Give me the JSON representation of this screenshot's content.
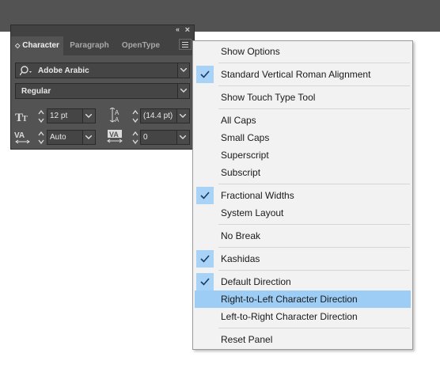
{
  "panel": {
    "collapse_glyph": "«",
    "close_glyph": "×",
    "tabs": [
      {
        "label": "Character",
        "active": true
      },
      {
        "label": "Paragraph",
        "active": false
      },
      {
        "label": "OpenType",
        "active": false
      }
    ],
    "font_family": "Adobe Arabic",
    "font_style": "Regular",
    "font_size": "12 pt",
    "leading": "(14.4 pt)",
    "kerning": "Auto",
    "tracking": "0"
  },
  "menu": {
    "items": [
      {
        "label": "Show Options",
        "checked": false,
        "highlighted": false
      },
      {
        "label": "Standard Vertical Roman Alignment",
        "checked": true,
        "highlighted": false
      },
      {
        "label": "Show Touch Type Tool",
        "checked": false,
        "highlighted": false
      },
      {
        "label": "All Caps",
        "checked": false,
        "highlighted": false
      },
      {
        "label": "Small Caps",
        "checked": false,
        "highlighted": false
      },
      {
        "label": "Superscript",
        "checked": false,
        "highlighted": false
      },
      {
        "label": "Subscript",
        "checked": false,
        "highlighted": false
      },
      {
        "label": "Fractional Widths",
        "checked": true,
        "highlighted": false
      },
      {
        "label": "System Layout",
        "checked": false,
        "highlighted": false
      },
      {
        "label": "No Break",
        "checked": false,
        "highlighted": false
      },
      {
        "label": "Kashidas",
        "checked": true,
        "highlighted": false
      },
      {
        "label": "Default Direction",
        "checked": true,
        "highlighted": false
      },
      {
        "label": "Right-to-Left Character Direction",
        "checked": false,
        "highlighted": true
      },
      {
        "label": "Left-to-Right Character Direction",
        "checked": false,
        "highlighted": false
      },
      {
        "label": "Reset Panel",
        "checked": false,
        "highlighted": false
      }
    ]
  },
  "colors": {
    "panel_bg": "#535353",
    "menu_bg": "#f2f2f2",
    "highlight": "#9dcdf5",
    "check_bg": "#a9d3f6"
  }
}
